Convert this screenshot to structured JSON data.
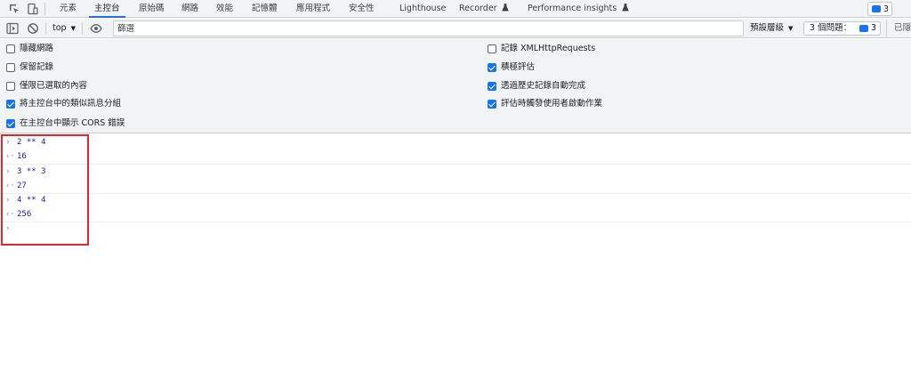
{
  "tabs": [
    {
      "label": "元素"
    },
    {
      "label": "主控台"
    },
    {
      "label": "原始碼"
    },
    {
      "label": "網路"
    },
    {
      "label": "效能"
    },
    {
      "label": "記憶體"
    },
    {
      "label": "應用程式"
    },
    {
      "label": "安全性"
    },
    {
      "label": "Lighthouse"
    },
    {
      "label": "Recorder"
    },
    {
      "label": "Performance insights"
    }
  ],
  "tab_icons": [
    "inspect-icon",
    "device-toggle-icon",
    "flask-icon"
  ],
  "issues_badge": {
    "count": "3",
    "icon": "issue-message-icon"
  },
  "toolbar": {
    "context": "top",
    "filter_placeholder": "篩選",
    "levels": "預設層級",
    "issues_label": "3 個問題：",
    "issues_count": "3",
    "hidden_label": "已隱"
  },
  "toolbar_icons": [
    "sidebar-toggle-icon",
    "clear-console-icon",
    "eye-icon"
  ],
  "settings": {
    "left": [
      {
        "label": "隱藏網路",
        "checked": false
      },
      {
        "label": "保留記錄",
        "checked": false
      },
      {
        "label": "僅限已選取的內容",
        "checked": false
      },
      {
        "label": "將主控台中的類似訊息分組",
        "checked": true
      },
      {
        "label": "在主控台中顯示 CORS 錯誤",
        "checked": true
      }
    ],
    "right": [
      {
        "label": "記錄 XMLHttpRequests",
        "checked": false
      },
      {
        "label": "積極評估",
        "checked": true
      },
      {
        "label": "透過歷史記錄自動完成",
        "checked": true
      },
      {
        "label": "評估時觸發使用者啟動作業",
        "checked": true
      }
    ]
  },
  "console": {
    "rows": [
      {
        "kind": "input",
        "text": "2 ** 4"
      },
      {
        "kind": "result",
        "text": "16"
      },
      {
        "kind": "input",
        "text": "3 ** 3"
      },
      {
        "kind": "result",
        "text": "27"
      },
      {
        "kind": "input",
        "text": "4 ** 4"
      },
      {
        "kind": "result",
        "text": "256"
      },
      {
        "kind": "prompt",
        "text": ""
      }
    ]
  },
  "colors": {
    "accent": "#1a73e8",
    "highlight": "#e8232a"
  }
}
